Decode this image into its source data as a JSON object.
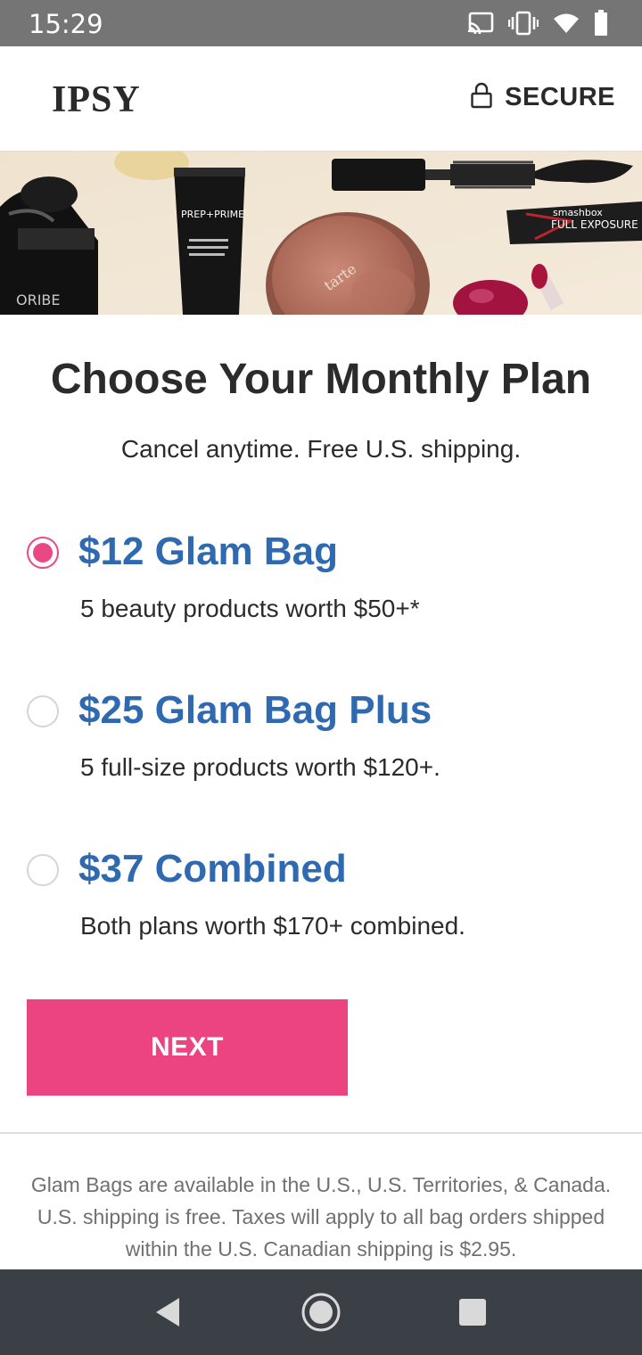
{
  "status_bar": {
    "time": "15:29",
    "icons": [
      "cast-icon",
      "vibrate-icon",
      "wifi-icon",
      "battery-icon"
    ]
  },
  "header": {
    "logo_text": "IPSY",
    "secure_label": "SECURE",
    "secure_icon": "lock-icon"
  },
  "banner": {
    "product_labels": [
      "ORIBE",
      "PREP+PRIME",
      "tarte",
      "smashbox",
      "FULL EXPOSURE"
    ]
  },
  "page": {
    "title": "Choose Your Monthly Plan",
    "subtitle": "Cancel anytime. Free U.S. shipping."
  },
  "plans": [
    {
      "name": "$12 Glam Bag",
      "description": "5 beauty products worth $50+*",
      "selected": true
    },
    {
      "name": "$25 Glam Bag Plus",
      "description": "5 full-size products worth $120+.",
      "selected": false
    },
    {
      "name": "$37 Combined",
      "description": "Both plans worth $170+ combined.",
      "selected": false
    }
  ],
  "next_button": {
    "label": "NEXT"
  },
  "footer": {
    "note": "Glam Bags are available in the U.S., U.S. Territories, & Canada. U.S. shipping is free. Taxes will apply to all bag orders shipped within the U.S. Canadian shipping is $2.95."
  },
  "nav_bar": {
    "buttons": [
      "back-icon",
      "home-icon",
      "recents-icon"
    ]
  },
  "colors": {
    "accent_pink": "#ec4480",
    "plan_blue": "#2f6ab1",
    "status_bar": "#757575",
    "nav_bar": "#3b4047"
  }
}
